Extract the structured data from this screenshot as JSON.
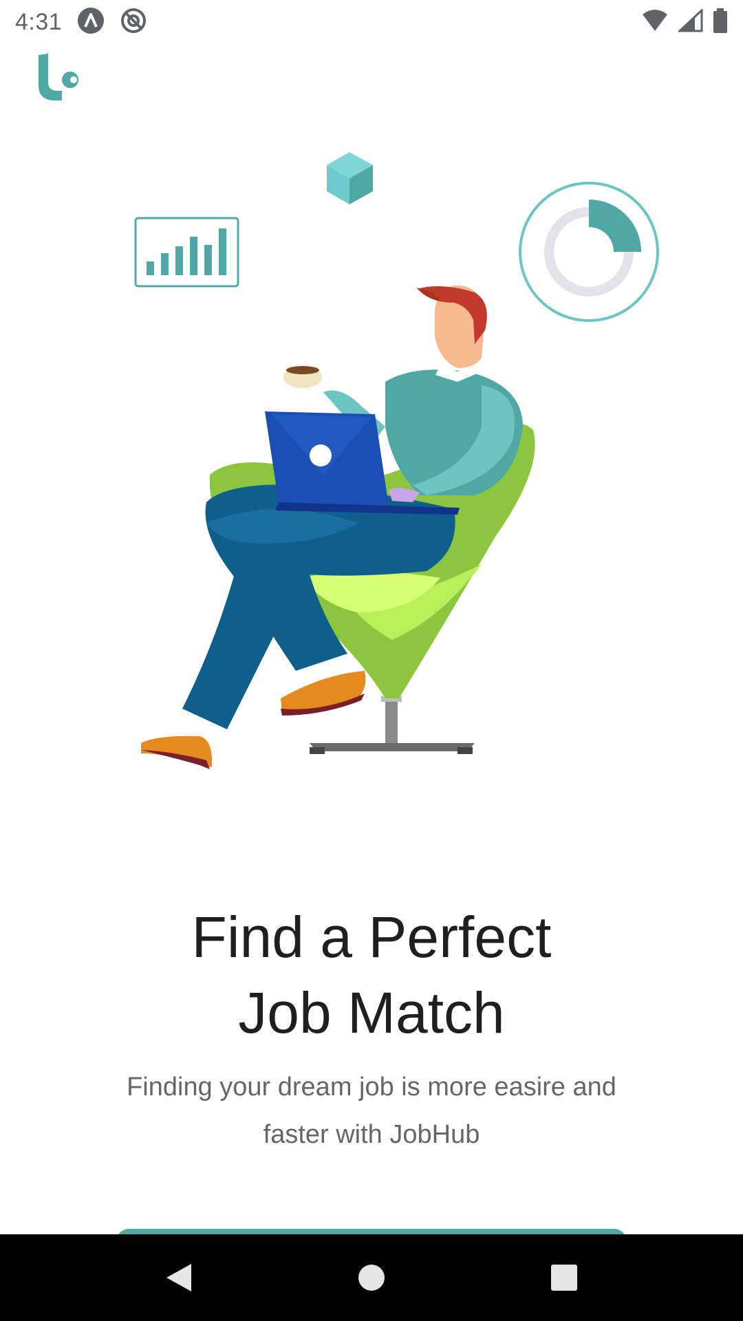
{
  "status_bar": {
    "time": "4:31",
    "left_icons": [
      "android-auto-icon",
      "sync-off-icon"
    ],
    "right_icons": [
      "wifi-icon",
      "cellular-signal-icon",
      "battery-icon"
    ]
  },
  "app": {
    "logo": "jobhub-logo-icon",
    "accent_color": "#4fa8a4"
  },
  "onboarding": {
    "headline_line1": "Find a Perfect",
    "headline_line2": "Job Match",
    "subtitle_line1": "Finding your dream job is more easire and",
    "subtitle_line2": "faster with JobHub"
  },
  "illustration": {
    "elements": [
      "bar-chart-icon",
      "cube-icon",
      "donut-chart-icon",
      "person-in-chair-with-laptop"
    ]
  },
  "nav_bar": {
    "buttons": [
      "back-icon",
      "home-icon",
      "recents-icon"
    ]
  }
}
